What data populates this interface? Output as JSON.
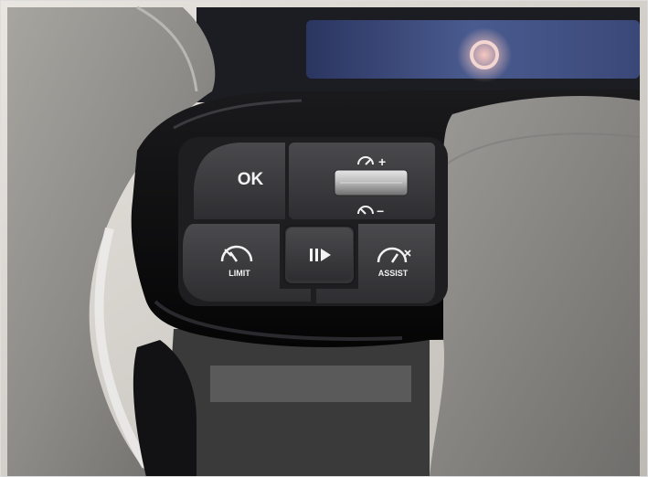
{
  "scene": {
    "subject": "steering-wheel-control-pad",
    "colors": {
      "leather": "#8c8a86",
      "leather_dark": "#5e5d5a",
      "gloss_bezel": "#0b0b0c",
      "button_face": "#3c3c3e",
      "button_text": "#f2f2f2",
      "dash_screen": "#3b4a7a",
      "background": "#d9d6d1"
    }
  },
  "buttons": {
    "ok": {
      "label": "OK",
      "icon": null
    },
    "speed_roller": {
      "up_icon": "speed-plus-icon",
      "down_icon": "speed-minus-icon",
      "up_text": "+",
      "down_text": "−"
    },
    "limit": {
      "label": "LIMIT",
      "icon": "speed-limit-icon"
    },
    "pause_resume": {
      "label": "",
      "icon": "pause-play-icon"
    },
    "assist": {
      "label": "ASSIST",
      "icon": "drive-assist-icon"
    }
  }
}
